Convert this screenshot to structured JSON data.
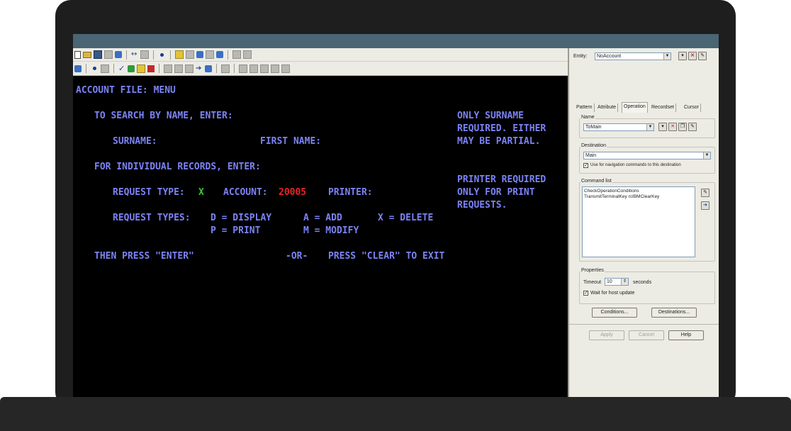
{
  "terminal": {
    "title": "ACCOUNT FILE: MENU",
    "search_prompt": "TO SEARCH BY NAME, ENTER:",
    "surname_label": "SURNAME:",
    "first_name_label": "FIRST NAME:",
    "hint_surname_1": "ONLY SURNAME",
    "hint_surname_2": "REQUIRED. EITHER",
    "hint_surname_3": "MAY BE PARTIAL.",
    "individual_prompt": "FOR INDIVIDUAL RECORDS, ENTER:",
    "hint_printer_1": "PRINTER REQUIRED",
    "hint_printer_2": "ONLY FOR PRINT",
    "hint_printer_3": "REQUESTS.",
    "request_type_label": "REQUEST TYPE:",
    "request_type_value": "X",
    "account_label": "ACCOUNT:",
    "account_value": "20005",
    "printer_label": "PRINTER:",
    "request_types_label": "REQUEST TYPES:",
    "rt_display": "D = DISPLAY",
    "rt_add": "A = ADD",
    "rt_delete": "X = DELETE",
    "rt_print": "P = PRINT",
    "rt_modify": "M = MODIFY",
    "then_press": "THEN PRESS \"ENTER\"",
    "or_label": "-OR-",
    "press_clear": "PRESS \"CLEAR\" TO EXIT"
  },
  "panel": {
    "entity_label": "Entity:",
    "entity_value": "NoAccount",
    "tabs": [
      "Pattern",
      "Attribute",
      "Operation",
      "Recordset",
      "Cursor"
    ],
    "name_label": "Name",
    "name_value": "ToMain",
    "destination_label": "Destination",
    "destination_value": "Main",
    "use_nav_label": "Use for navigation commands to this destination",
    "command_list_label": "Command list",
    "commands": [
      "CheckOperationConditions",
      "TransmitTerminalKey rcIBMClearKey"
    ],
    "properties_label": "Properties",
    "timeout_label": "Timeout",
    "timeout_value": "10",
    "timeout_unit": "seconds",
    "wait_label": "Wait for host update",
    "conditions_button": "Conditions...",
    "destinations_button": "Destinations...",
    "apply_button": "Apply",
    "cancel_button": "Cancel",
    "help_button": "Help"
  }
}
